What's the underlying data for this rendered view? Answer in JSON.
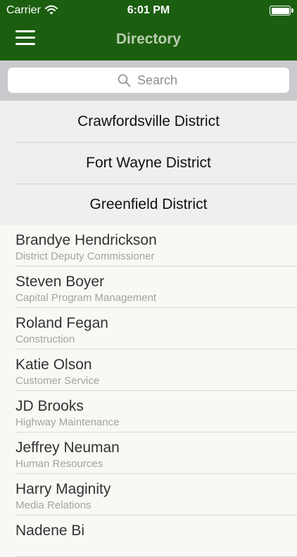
{
  "status_bar": {
    "carrier": "Carrier",
    "time": "6:01 PM",
    "battery_level": 1.0
  },
  "nav": {
    "title": "Directory",
    "menu_icon": "hamburger-icon"
  },
  "search": {
    "placeholder": "Search",
    "icon": "search-icon"
  },
  "districts": [
    {
      "label": "Crawfordsville District"
    },
    {
      "label": "Fort Wayne District"
    },
    {
      "label": "Greenfield District"
    }
  ],
  "people": [
    {
      "name": "Brandye Hendrickson",
      "role": "District Deputy Commissioner"
    },
    {
      "name": "Steven Boyer",
      "role": "Capital Program Management"
    },
    {
      "name": "Roland Fegan",
      "role": "Construction"
    },
    {
      "name": "Katie Olson",
      "role": "Customer Service"
    },
    {
      "name": "JD Brooks",
      "role": "Highway Maintenance"
    },
    {
      "name": "Jeffrey Neuman",
      "role": "Human Resources"
    },
    {
      "name": "Harry Maginity",
      "role": "Media Relations"
    },
    {
      "name": "Nadene Bi",
      "role": ""
    }
  ],
  "colors": {
    "nav_bar": "#1c5e0f",
    "nav_title": "#b9cdb2",
    "search_bg": "#c9c9ce",
    "district_bg": "#efefef",
    "list_bg": "#f8f8f5"
  }
}
